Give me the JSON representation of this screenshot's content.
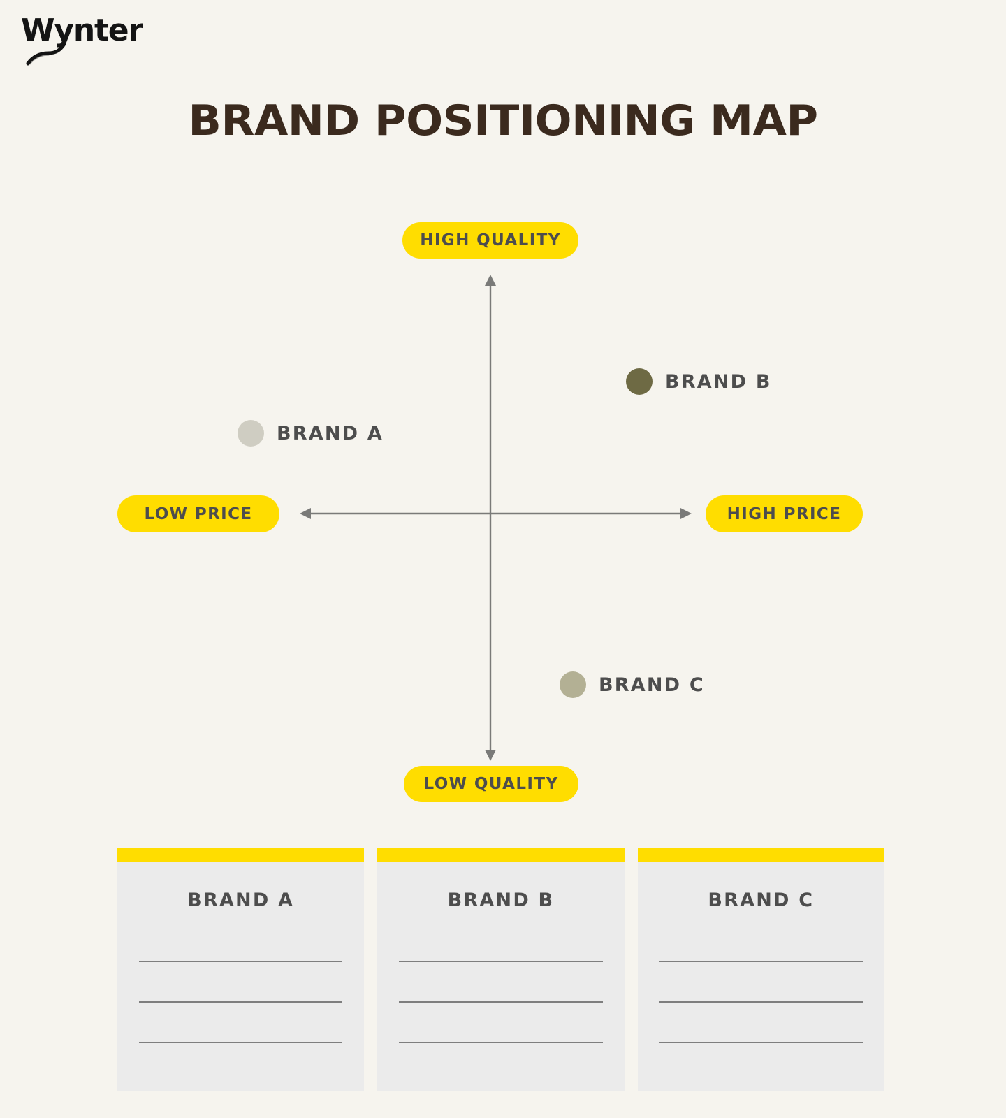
{
  "brand": {
    "logo_text": "Wynter",
    "logo_icon": "swoosh-underline"
  },
  "header": {
    "title": "BRAND POSITIONING MAP"
  },
  "colors": {
    "background": "#F6F4EE",
    "accent_yellow": "#FFDD00",
    "title_brown": "#3B2A1E",
    "label_gray": "#4D4D4D",
    "axis_gray": "#7A7A78",
    "card_bg": "#EBEBEB"
  },
  "chart_data": {
    "type": "scatter",
    "title": "BRAND POSITIONING MAP",
    "xlabel_low": "LOW PRICE",
    "xlabel_high": "HIGH PRICE",
    "ylabel_low": "LOW QUALITY",
    "ylabel_high": "HIGH QUALITY",
    "xlim": [
      -1,
      1
    ],
    "ylim": [
      -1,
      1
    ],
    "grid": false,
    "legend": "inline-labels",
    "axis_labels": {
      "top": "HIGH QUALITY",
      "bottom": "LOW QUALITY",
      "left": "LOW PRICE",
      "right": "HIGH PRICE"
    },
    "points": [
      {
        "name": "BRAND A",
        "x": -0.65,
        "y": 0.35,
        "color": "#CFCDC2"
      },
      {
        "name": "BRAND B",
        "x": 0.52,
        "y": 0.56,
        "color": "#6E6A44"
      },
      {
        "name": "BRAND C",
        "x": 0.26,
        "y": -0.71,
        "color": "#B3B094"
      }
    ]
  },
  "markers": [
    {
      "label": "BRAND A",
      "color": "#CFCDC2"
    },
    {
      "label": "BRAND B",
      "color": "#6E6A44"
    },
    {
      "label": "BRAND C",
      "color": "#B3B094"
    }
  ],
  "cards": [
    {
      "title": "BRAND A",
      "lines": [
        "",
        "",
        ""
      ]
    },
    {
      "title": "BRAND B",
      "lines": [
        "",
        "",
        ""
      ]
    },
    {
      "title": "BRAND C",
      "lines": [
        "",
        "",
        ""
      ]
    }
  ]
}
